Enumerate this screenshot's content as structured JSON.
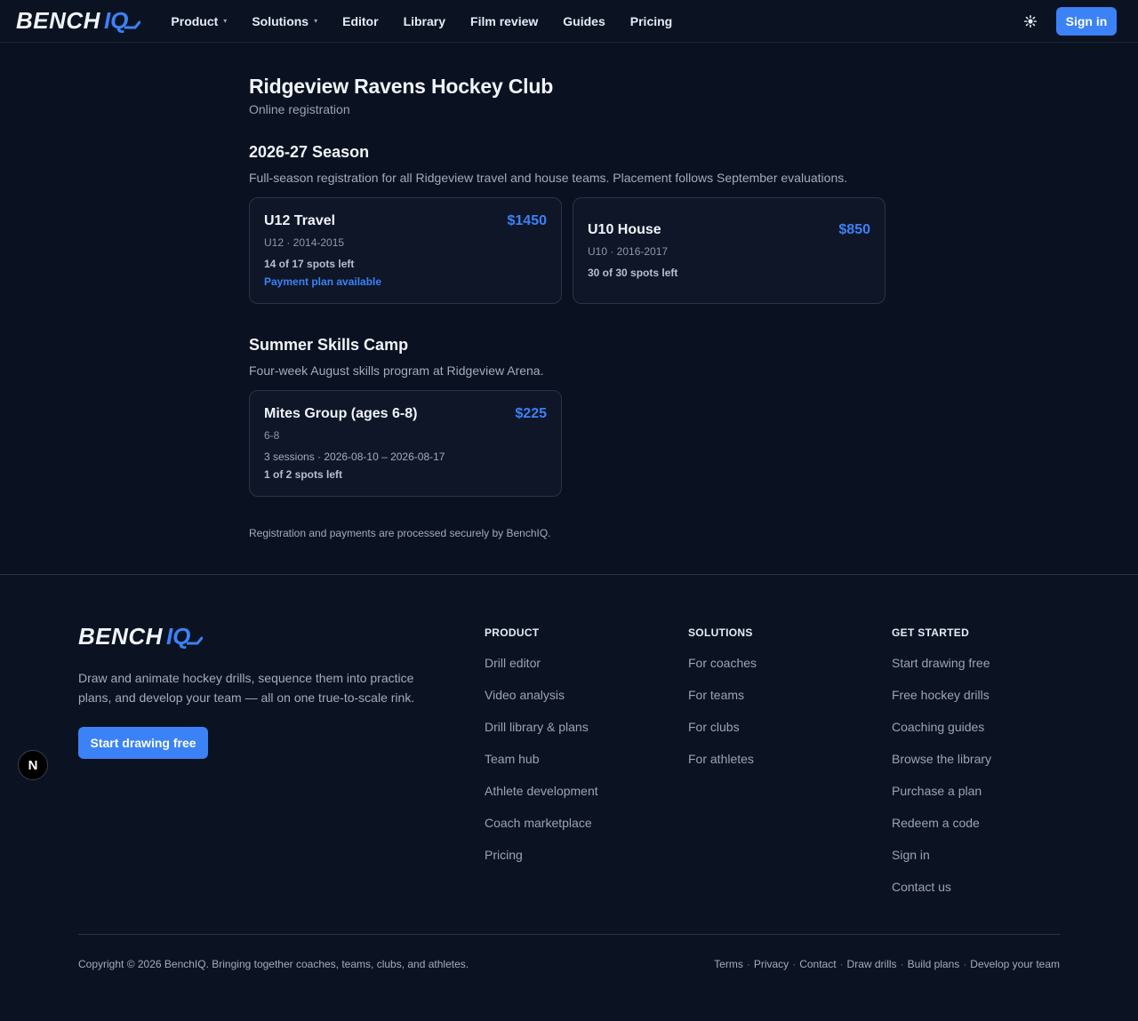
{
  "brand": {
    "word1": "BENCH",
    "word2": "IQ"
  },
  "nav": {
    "items": [
      {
        "label": "Product",
        "dropdown": true
      },
      {
        "label": "Solutions",
        "dropdown": true
      },
      {
        "label": "Editor",
        "dropdown": false
      },
      {
        "label": "Library",
        "dropdown": false
      },
      {
        "label": "Film review",
        "dropdown": false
      },
      {
        "label": "Guides",
        "dropdown": false
      },
      {
        "label": "Pricing",
        "dropdown": false
      }
    ],
    "signin_label": "Sign in",
    "theme_icon": "sun-icon"
  },
  "page": {
    "title": "Ridgeview Ravens Hockey Club",
    "subtitle": "Online registration",
    "sections": [
      {
        "title": "2026-27 Season",
        "description": "Full-season registration for all Ridgeview travel and house teams. Placement follows September evaluations.",
        "programs": [
          {
            "name": "U12 Travel",
            "price": "$1450",
            "meta": "U12 · 2014-2015",
            "spots": "14 of 17 spots left",
            "note": "Payment plan available"
          },
          {
            "name": "U10 House",
            "price": "$850",
            "meta": "U10 · 2016-2017",
            "spots": "30 of 30 spots left"
          }
        ]
      },
      {
        "title": "Summer Skills Camp",
        "description": "Four-week August skills program at Ridgeview Arena.",
        "programs": [
          {
            "name": "Mites Group (ages 6-8)",
            "price": "$225",
            "meta": "6-8",
            "sessions": "3 sessions · 2026-08-10 – 2026-08-17",
            "spots": "1 of 2 spots left"
          }
        ]
      }
    ],
    "secure_note": "Registration and payments are processed securely by BenchIQ."
  },
  "footer": {
    "description": "Draw and animate hockey drills, sequence them into practice plans, and develop your team — all on one true-to-scale rink.",
    "cta_label": "Start drawing free",
    "columns": [
      {
        "heading": "PRODUCT",
        "links": [
          "Drill editor",
          "Video analysis",
          "Drill library & plans",
          "Team hub",
          "Athlete development",
          "Coach marketplace",
          "Pricing"
        ]
      },
      {
        "heading": "SOLUTIONS",
        "links": [
          "For coaches",
          "For teams",
          "For clubs",
          "For athletes"
        ]
      },
      {
        "heading": "GET STARTED",
        "links": [
          "Start drawing free",
          "Free hockey drills",
          "Coaching guides",
          "Browse the library",
          "Purchase a plan",
          "Redeem a code",
          "Sign in",
          "Contact us"
        ]
      }
    ],
    "copyright": "Copyright © 2026 BenchIQ. Bringing together coaches, teams, clubs, and athletes.",
    "legal_links": [
      "Terms",
      "Privacy",
      "Contact",
      "Draw drills",
      "Build plans",
      "Develop your team"
    ]
  },
  "dev_badge": "N",
  "colors": {
    "accent": "#3b82f6",
    "background": "#0a1120",
    "card": "#0e1628"
  }
}
